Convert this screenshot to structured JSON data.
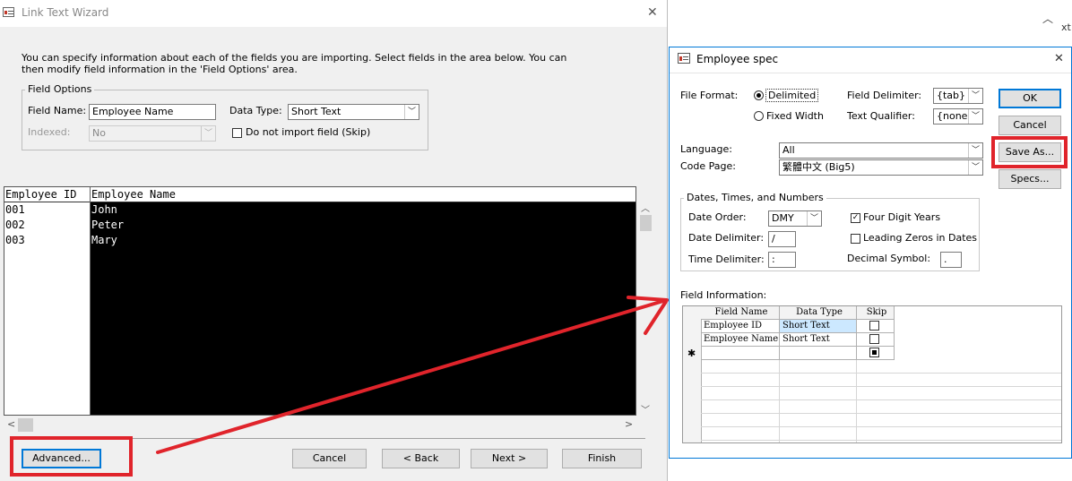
{
  "wizard": {
    "title": "Link Text Wizard",
    "close_glyph": "✕",
    "instructions": "You can specify information about each of the fields you are importing. Select fields in the area below. You can then modify field information in the 'Field Options' area.",
    "field_options": {
      "group_label": "Field Options",
      "field_name_label": "Field Name:",
      "field_name_value": "Employee Name",
      "data_type_label": "Data Type:",
      "data_type_value": "Short Text",
      "indexed_label": "Indexed:",
      "indexed_value": "No",
      "skip_label": "Do not import field (Skip)"
    },
    "preview": {
      "columns": [
        "Employee ID",
        "Employee Name"
      ],
      "rows": [
        [
          "001",
          "John"
        ],
        [
          "002",
          "Peter"
        ],
        [
          "003",
          "Mary"
        ]
      ]
    },
    "buttons": {
      "advanced": "Advanced...",
      "cancel": "Cancel",
      "back": "< Back",
      "next": "Next >",
      "finish": "Finish"
    }
  },
  "background_fragment": "xt",
  "spec": {
    "title": "Employee spec",
    "close_glyph": "✕",
    "file_format_label": "File Format:",
    "delimited_label": "Delimited",
    "fixed_width_label": "Fixed Width",
    "field_delimiter_label": "Field Delimiter:",
    "field_delimiter_value": "{tab}",
    "text_qualifier_label": "Text Qualifier:",
    "text_qualifier_value": "{none}",
    "language_label": "Language:",
    "language_value": "All",
    "code_page_label": "Code Page:",
    "code_page_value": "繁體中文 (Big5)",
    "dates_group_label": "Dates, Times, and Numbers",
    "date_order_label": "Date Order:",
    "date_order_value": "DMY",
    "four_digit_years_label": "Four Digit Years",
    "date_delimiter_label": "Date Delimiter:",
    "date_delimiter_value": "/",
    "leading_zeros_label": "Leading Zeros in Dates",
    "time_delimiter_label": "Time Delimiter:",
    "time_delimiter_value": ":",
    "decimal_symbol_label": "Decimal Symbol:",
    "decimal_symbol_value": ".",
    "field_information_label": "Field Information:",
    "grid_headers": [
      "Field Name",
      "Data Type",
      "Skip"
    ],
    "grid_rows": [
      {
        "name": "Employee ID",
        "type": "Short Text"
      },
      {
        "name": "Employee Name",
        "type": "Short Text"
      }
    ],
    "new_row_marker": "✱",
    "buttons": {
      "ok": "OK",
      "cancel": "Cancel",
      "save_as": "Save As...",
      "specs": "Specs..."
    }
  },
  "colors": {
    "accent": "#0078d7",
    "annotation_red": "#e0242b",
    "selection_blue": "#cce8ff"
  }
}
